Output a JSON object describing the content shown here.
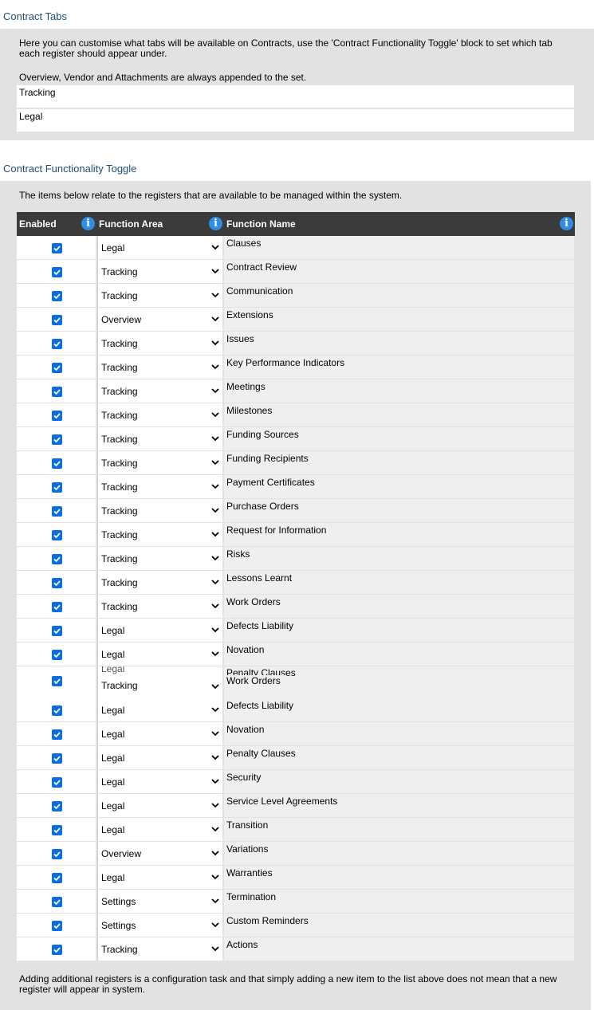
{
  "tabs_section": {
    "title": "Contract Tabs",
    "description": "Here you can customise what tabs will be available on Contracts, use the 'Contract Functionality Toggle' block to set which tab each register should appear under.",
    "note": "Overview, Vendor and Attachments are always appended to the set.",
    "tabs": [
      "Tracking",
      "Legal"
    ]
  },
  "toggle_section": {
    "title": "Contract Functionality Toggle",
    "description": "The items below relate to the registers that are available to be managed within the system.",
    "columns": {
      "enabled": "Enabled",
      "area": "Function Area",
      "name": "Function Name"
    },
    "info_glyph": "i",
    "rows": [
      {
        "enabled": true,
        "area": "Legal",
        "name": "Clauses"
      },
      {
        "enabled": true,
        "area": "Tracking",
        "name": "Contract Review"
      },
      {
        "enabled": true,
        "area": "Tracking",
        "name": "Communication"
      },
      {
        "enabled": true,
        "area": "Overview",
        "name": "Extensions"
      },
      {
        "enabled": true,
        "area": "Tracking",
        "name": "Issues"
      },
      {
        "enabled": true,
        "area": "Tracking",
        "name": "Key Performance Indicators"
      },
      {
        "enabled": true,
        "area": "Tracking",
        "name": "Meetings"
      },
      {
        "enabled": true,
        "area": "Tracking",
        "name": "Milestones"
      },
      {
        "enabled": true,
        "area": "Tracking",
        "name": "Funding Sources"
      },
      {
        "enabled": true,
        "area": "Tracking",
        "name": "Funding Recipients"
      },
      {
        "enabled": true,
        "area": "Tracking",
        "name": "Payment Certificates"
      },
      {
        "enabled": true,
        "area": "Tracking",
        "name": "Purchase Orders"
      },
      {
        "enabled": true,
        "area": "Tracking",
        "name": "Request for Information"
      },
      {
        "enabled": true,
        "area": "Tracking",
        "name": "Risks"
      },
      {
        "enabled": true,
        "area": "Tracking",
        "name": "Lessons Learnt"
      },
      {
        "enabled": true,
        "area": "Tracking",
        "name": "Work Orders"
      },
      {
        "enabled": true,
        "area": "Legal",
        "name": "Defects Liability"
      },
      {
        "enabled": true,
        "area": "Legal",
        "name": "Novation"
      }
    ],
    "glitch_row": {
      "enabled": true,
      "area_behind": "Legal",
      "area_front": "Tracking",
      "name_behind": "Penalty Clauses",
      "name_front": "Work Orders"
    },
    "rows_after": [
      {
        "enabled": true,
        "area": "Legal",
        "name": "Defects Liability"
      },
      {
        "enabled": true,
        "area": "Legal",
        "name": "Novation"
      },
      {
        "enabled": true,
        "area": "Legal",
        "name": "Penalty Clauses"
      },
      {
        "enabled": true,
        "area": "Legal",
        "name": "Security"
      },
      {
        "enabled": true,
        "area": "Legal",
        "name": "Service Level Agreements"
      },
      {
        "enabled": true,
        "area": "Legal",
        "name": "Transition"
      },
      {
        "enabled": true,
        "area": "Overview",
        "name": "Variations"
      },
      {
        "enabled": true,
        "area": "Legal",
        "name": "Warranties"
      },
      {
        "enabled": true,
        "area": "Settings",
        "name": "Termination"
      },
      {
        "enabled": true,
        "area": "Settings",
        "name": "Custom Reminders"
      },
      {
        "enabled": true,
        "area": "Tracking",
        "name": "Actions"
      }
    ],
    "footer": "Adding additional registers is a configuration task and that simply adding a new item to the list above does not mean that a new register will appear in system."
  },
  "colors": {
    "header_bg": "#3b3b3b",
    "accent": "#0b6ee0",
    "info": "#2f8de4",
    "title": "#1f4e79",
    "panel": "#e2e2e2"
  }
}
